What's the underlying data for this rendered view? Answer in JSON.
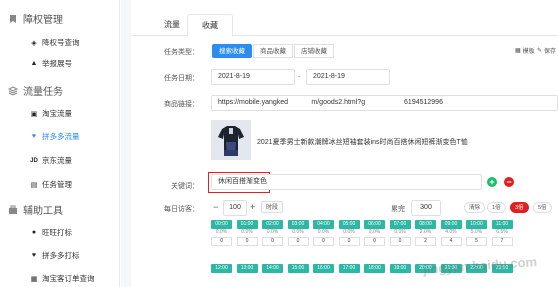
{
  "sidebar": {
    "sections": [
      {
        "label": "障权管理",
        "icon": "bookmark-icon"
      },
      {
        "label": "流量任务",
        "icon": "layers-icon"
      },
      {
        "label": "辅助工具",
        "icon": "toolbox-icon"
      }
    ],
    "items": [
      {
        "label": "降权号查询",
        "icon": "shield-icon"
      },
      {
        "label": "举报展号",
        "icon": "warning-icon"
      },
      {
        "label": "淘宝流量",
        "icon": "shop-icon"
      },
      {
        "label": "拼多多流量",
        "icon": "heart-icon"
      },
      {
        "label": "京东流量",
        "icon": "jd-icon"
      },
      {
        "label": "任务管理",
        "icon": "clipboard-icon"
      },
      {
        "label": "旺旺打标",
        "icon": "tag-icon"
      },
      {
        "label": "拼多多打标",
        "icon": "heart-tag-icon"
      },
      {
        "label": "淘宝客订单查询",
        "icon": "search-doc-icon"
      }
    ]
  },
  "tabs": [
    {
      "label": "流量"
    },
    {
      "label": "收藏"
    }
  ],
  "form": {
    "task_type_label": "任务类型：",
    "task_types": [
      "搜索收藏",
      "商品收藏",
      "店铺收藏"
    ],
    "templates_label": "模板",
    "save_label": "保存",
    "date_label": "任务日期：",
    "date_start": "2021-8-19",
    "date_end": "2021-8-19",
    "date_sep": "-",
    "link_label": "商品链接：",
    "link_value": "https://mobile.yangked      m/goods2.html?g          6194512996",
    "product_title": "2021夏季男士新款潮牌冰丝短袖套装ins时尚百搭休闲短裤渐变色T恤",
    "keyword_label": "关键词：",
    "keyword_value": "休闲百搭渐变色",
    "visitors_label": "每日访客：",
    "visitors_value": "100",
    "minus": "−",
    "plus": "+",
    "time_btn": "时段",
    "total_label": "累完",
    "total_value": "300",
    "clear_label": "清除",
    "pills": [
      "1倍",
      "3倍",
      "5倍"
    ],
    "active_pill": "3倍"
  },
  "schedule": {
    "row1": [
      {
        "time": "00:00",
        "pct": "0.0%",
        "count": "0"
      },
      {
        "time": "01:00",
        "pct": "0.0%",
        "count": "0"
      },
      {
        "time": "02:00",
        "pct": "0.0%",
        "count": "0"
      },
      {
        "time": "03:00",
        "pct": "0.0%",
        "count": "0"
      },
      {
        "time": "04:00",
        "pct": "0.0%",
        "count": "0"
      },
      {
        "time": "05:00",
        "pct": "0.0%",
        "count": "0"
      },
      {
        "time": "06:00",
        "pct": "0.0%",
        "count": "0"
      },
      {
        "time": "07:00",
        "pct": "0.0%",
        "count": "0"
      },
      {
        "time": "08:00",
        "pct": "2.0%",
        "count": "2"
      },
      {
        "time": "09:00",
        "pct": "4.0%",
        "count": "4"
      },
      {
        "time": "10:00",
        "pct": "5.0%",
        "count": "5"
      },
      {
        "time": "11:00",
        "pct": "6.5%",
        "count": "7"
      }
    ],
    "row2": [
      {
        "time": "12:00"
      },
      {
        "time": "13:00"
      },
      {
        "time": "14:00"
      },
      {
        "time": "15:00"
      },
      {
        "time": "16:00"
      },
      {
        "time": "17:00"
      },
      {
        "time": "18:00"
      },
      {
        "time": "19:00"
      },
      {
        "time": "20:00"
      },
      {
        "time": "21:00"
      },
      {
        "time": "22:00"
      },
      {
        "time": "23:00"
      }
    ]
  },
  "watermark": "jingyan.baidu.com",
  "colors": {
    "primary": "#2d8cf0",
    "danger": "#e02020",
    "success": "#19be6b",
    "slot": "#2db7a5"
  }
}
